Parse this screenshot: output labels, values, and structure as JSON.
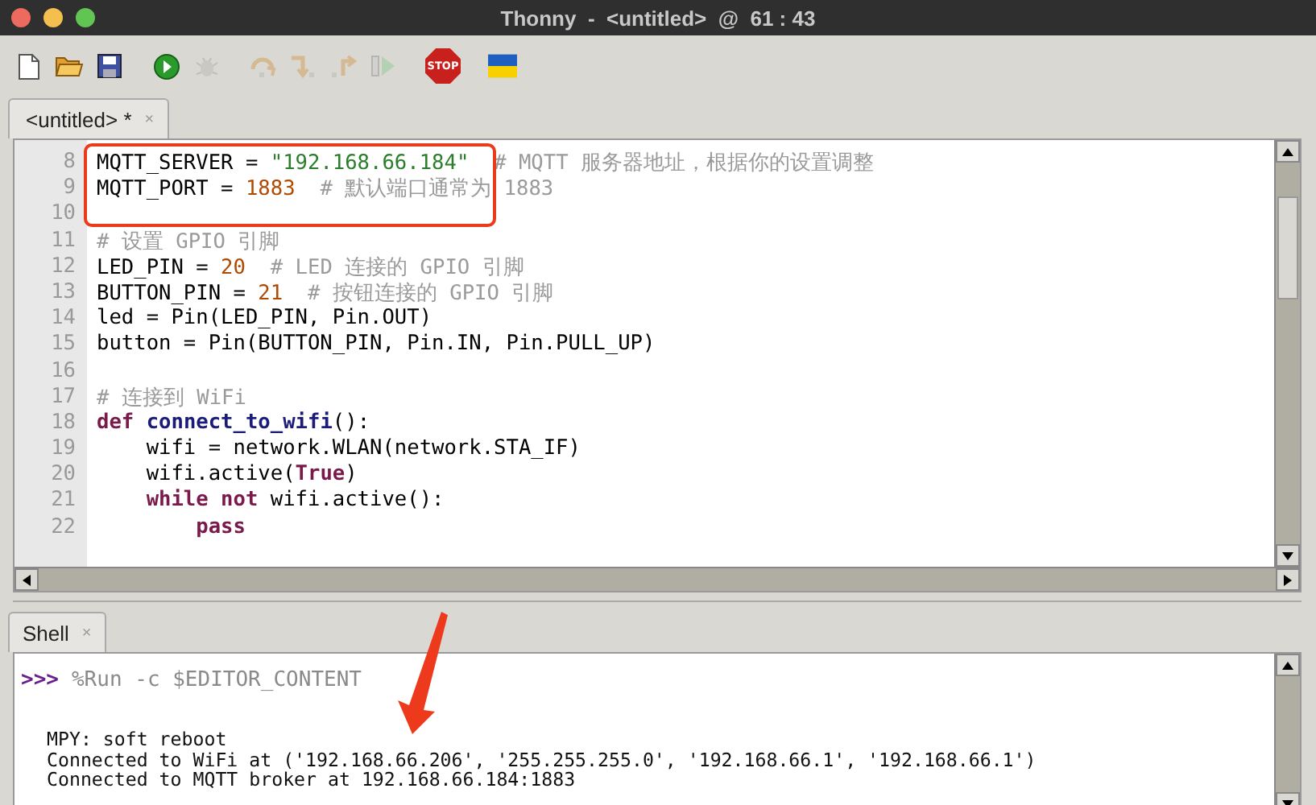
{
  "window": {
    "title": "Thonny  -  <untitled>  @  61 : 43"
  },
  "toolbar": {
    "groups": [
      [
        {
          "kind": "new",
          "disabled": false
        },
        {
          "kind": "open",
          "disabled": false
        },
        {
          "kind": "save",
          "disabled": false
        }
      ],
      [
        {
          "kind": "run",
          "disabled": false
        },
        {
          "kind": "debug",
          "disabled": true
        }
      ],
      [
        {
          "kind": "step-over",
          "disabled": true
        },
        {
          "kind": "step-into",
          "disabled": true
        },
        {
          "kind": "step-out",
          "disabled": true
        },
        {
          "kind": "resume",
          "disabled": true
        }
      ],
      [
        {
          "kind": "stop",
          "label": "STOP",
          "disabled": false
        }
      ],
      [
        {
          "kind": "flag",
          "disabled": false
        }
      ]
    ]
  },
  "editor": {
    "tab": {
      "label": "<untitled> *",
      "close": "×",
      "selected": true
    },
    "lines": [
      {
        "number": "8",
        "tokens": [
          {
            "kind": "plain",
            "text": "MQTT_SERVER = "
          },
          {
            "kind": "string",
            "text": "\"192.168.66.184\""
          },
          {
            "kind": "comment",
            "text": "  # MQTT 服务器地址，根据你的设置调整"
          }
        ]
      },
      {
        "number": "9",
        "tokens": [
          {
            "kind": "plain",
            "text": "MQTT_PORT = "
          },
          {
            "kind": "number",
            "text": "1883"
          },
          {
            "kind": "comment",
            "text": "  # 默认端口通常为 1883"
          }
        ]
      },
      {
        "number": "10"
      },
      {
        "number": "11",
        "tokens": [
          {
            "kind": "comment",
            "text": "# 设置 GPIO 引脚"
          }
        ]
      },
      {
        "number": "12",
        "tokens": [
          {
            "kind": "plain",
            "text": "LED_PIN = "
          },
          {
            "kind": "number",
            "text": "20"
          },
          {
            "kind": "comment",
            "text": "  # LED 连接的 GPIO 引脚"
          }
        ]
      },
      {
        "number": "13",
        "tokens": [
          {
            "kind": "plain",
            "text": "BUTTON_PIN = "
          },
          {
            "kind": "number",
            "text": "21"
          },
          {
            "kind": "comment",
            "text": "  # 按钮连接的 GPIO 引脚"
          }
        ]
      },
      {
        "number": "14",
        "tokens": [
          {
            "kind": "plain",
            "text": "led = Pin(LED_PIN, Pin.OUT)"
          }
        ]
      },
      {
        "number": "15",
        "tokens": [
          {
            "kind": "plain",
            "text": "button = Pin(BUTTON_PIN, Pin.IN, Pin.PULL_UP)"
          }
        ]
      },
      {
        "number": "16"
      },
      {
        "number": "17",
        "tokens": [
          {
            "kind": "comment",
            "text": "# 连接到 WiFi"
          }
        ]
      },
      {
        "number": "18",
        "tokens": [
          {
            "kind": "keyword",
            "text": "def"
          },
          {
            "kind": "function",
            "text": " connect_to_wifi"
          },
          {
            "kind": "plain",
            "text": "():"
          }
        ]
      },
      {
        "number": "19",
        "tokens": [
          {
            "kind": "plain",
            "text": "    wifi = network.WLAN(network.STA_IF)"
          }
        ]
      },
      {
        "number": "20",
        "tokens": [
          {
            "kind": "plain",
            "text": "    wifi.active("
          },
          {
            "kind": "keyword",
            "text": "True"
          },
          {
            "kind": "plain",
            "text": ")"
          }
        ]
      },
      {
        "number": "21",
        "tokens": [
          {
            "kind": "keyword",
            "text": "    while"
          },
          {
            "kind": "keyword",
            "text": " not"
          },
          {
            "kind": "plain",
            "text": " wifi.active():"
          }
        ]
      },
      {
        "number": "22",
        "tokens": [
          {
            "kind": "keyword",
            "text": "        pass"
          }
        ]
      }
    ]
  },
  "shell": {
    "tab": {
      "label": "Shell",
      "close": "×",
      "selected": true
    },
    "prompt": ">>>",
    "command": "%Run -c $EDITOR_CONTENT",
    "output": [
      "MPY: soft reboot",
      "Connected to WiFi at ('192.168.66.206', '255.255.255.0', '192.168.66.1', '192.168.66.1')",
      "Connected to MQTT broker at 192.168.66.184:1883"
    ]
  }
}
